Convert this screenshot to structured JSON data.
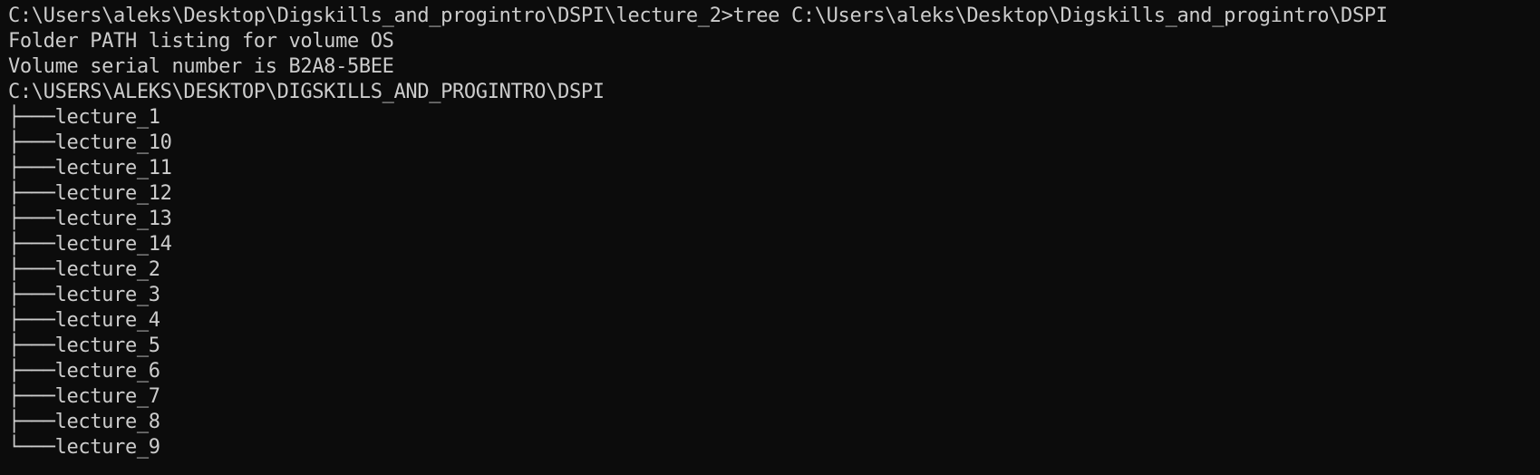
{
  "terminal": {
    "command_line": "C:\\Users\\aleks\\Desktop\\Digskills_and_progintro\\DSPI\\lecture_2>tree C:\\Users\\aleks\\Desktop\\Digskills_and_progintro\\DSPI",
    "header_line1": "Folder PATH listing for volume OS",
    "header_line2": "Volume serial number is B2A8-5BEE",
    "root_path": "C:\\USERS\\ALEKS\\DESKTOP\\DIGSKILLS_AND_PROGINTRO\\DSPI",
    "entries": [
      {
        "branch": "├───",
        "name": "lecture_1"
      },
      {
        "branch": "├───",
        "name": "lecture_10"
      },
      {
        "branch": "├───",
        "name": "lecture_11"
      },
      {
        "branch": "├───",
        "name": "lecture_12"
      },
      {
        "branch": "├───",
        "name": "lecture_13"
      },
      {
        "branch": "├───",
        "name": "lecture_14"
      },
      {
        "branch": "├───",
        "name": "lecture_2"
      },
      {
        "branch": "├───",
        "name": "lecture_3"
      },
      {
        "branch": "├───",
        "name": "lecture_4"
      },
      {
        "branch": "├───",
        "name": "lecture_5"
      },
      {
        "branch": "├───",
        "name": "lecture_6"
      },
      {
        "branch": "├───",
        "name": "lecture_7"
      },
      {
        "branch": "├───",
        "name": "lecture_8"
      },
      {
        "branch": "└───",
        "name": "lecture_9"
      }
    ],
    "colors": {
      "background": "#0c0c0c",
      "foreground": "#cccccc"
    }
  }
}
